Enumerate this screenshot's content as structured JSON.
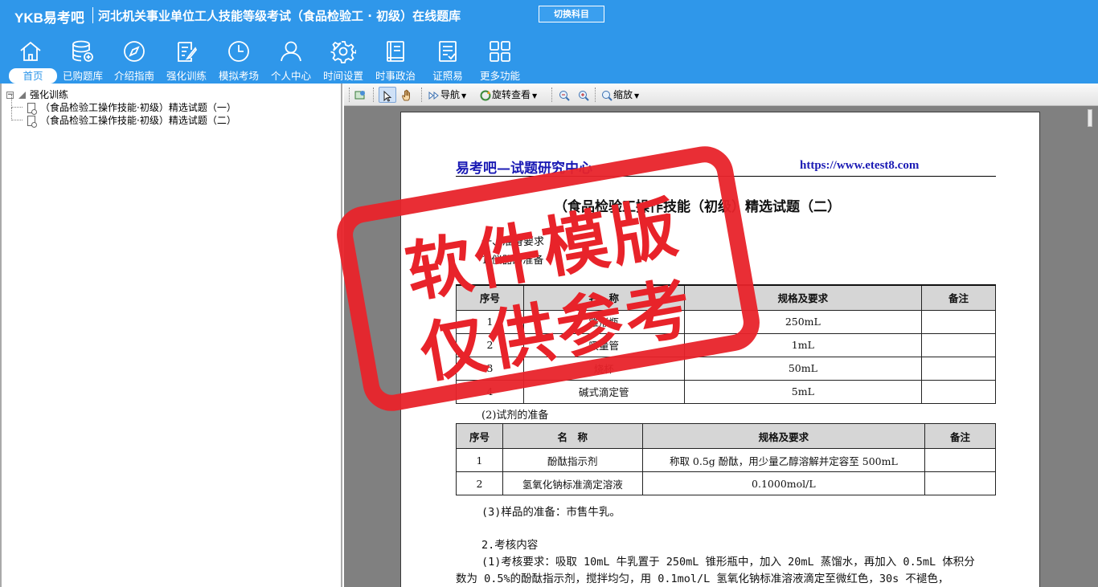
{
  "header": {
    "logo": "YKB易考吧",
    "title": "河北机关事业单位工人技能等级考试（食品检验工 · 初级）在线题库",
    "switch_label": "切换科目"
  },
  "nav": {
    "items": [
      {
        "label": "首页",
        "icon": "home-icon"
      },
      {
        "label": "已购题库",
        "icon": "database-icon"
      },
      {
        "label": "介绍指南",
        "icon": "compass-icon"
      },
      {
        "label": "强化训练",
        "icon": "edit-icon"
      },
      {
        "label": "模拟考场",
        "icon": "clock-icon"
      },
      {
        "label": "个人中心",
        "icon": "user-icon"
      },
      {
        "label": "时间设置",
        "icon": "gear-icon"
      },
      {
        "label": "时事政治",
        "icon": "book-icon"
      },
      {
        "label": "证照易",
        "icon": "checklist-icon"
      },
      {
        "label": "更多功能",
        "icon": "grid-icon"
      }
    ]
  },
  "tree": {
    "root": "强化训练",
    "children": [
      "（食品检验工操作技能·初级）精选试题（一）",
      "（食品检验工操作技能·初级）精选试题（二）"
    ]
  },
  "toolbar": {
    "nav_label": "导航",
    "rotate_label": "旋转查看",
    "zoom_label": "缩放"
  },
  "document": {
    "head_left": "易考吧—试题研究中心",
    "head_right": "https://www.etest8.com",
    "title": "（食品检验工操作技能（初级）精选试题（二）",
    "fragment_1": "一、准备要求",
    "fragment_2": "1.仪器的准备",
    "table1": {
      "headers": [
        "序号",
        "名　称",
        "规格及要求",
        "备注"
      ],
      "rows": [
        [
          "1",
          "锥形瓶",
          "250mL",
          ""
        ],
        [
          "2",
          "吸量管",
          "1mL",
          ""
        ],
        [
          "3",
          "烧杯",
          "50mL",
          ""
        ],
        [
          "4",
          "碱式滴定管",
          "5mL",
          ""
        ]
      ]
    },
    "section_2": "(2)试剂的准备",
    "table2": {
      "headers": [
        "序号",
        "名　称",
        "规格及要求",
        "备注"
      ],
      "rows": [
        [
          "1",
          "酚酞指示剂",
          "称取 0.5g 酚酞，用少量乙醇溶解并定容至 500mL",
          ""
        ],
        [
          "2",
          "氢氧化钠标准滴定溶液",
          "0.1000mol/L",
          ""
        ]
      ]
    },
    "sample_prep": "(3)样品的准备：市售牛乳。",
    "exam_heading": "2.考核内容",
    "exam_line_1": "(1)考核要求：吸取 10mL 牛乳置于 250mL 锥形瓶中，加入 20mL 蒸馏水，再加入 0.5mL 体积分",
    "exam_line_2": "数为 0.5%的酚酞指示剂，搅拌均匀，用 0.1mol/L 氢氧化钠标准溶液滴定至微红色，30s 不褪色，"
  },
  "watermark": {
    "line1": "软件模版",
    "line2": "仅供参考",
    "color": "#e8232a"
  },
  "colors": {
    "header_bg": "#2f97ea",
    "doc_head": "#1a1ab4"
  }
}
